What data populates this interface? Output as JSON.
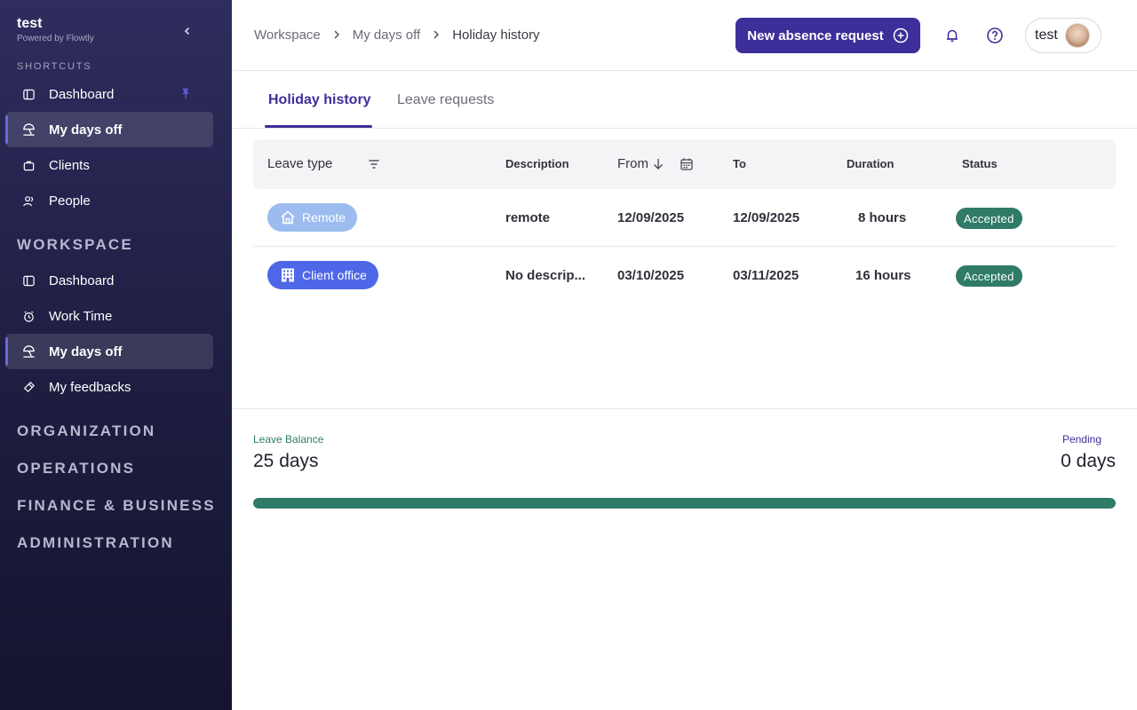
{
  "brand": {
    "name": "test",
    "tagline": "Powered by Flowtly"
  },
  "sidebar": {
    "shortcuts_title": "SHORTCUTS",
    "shortcuts": [
      {
        "label": "Dashboard",
        "icon": "layout-icon",
        "pinned": true
      },
      {
        "label": "My days off",
        "icon": "beach-icon",
        "active": true
      },
      {
        "label": "Clients",
        "icon": "briefcase-icon"
      },
      {
        "label": "People",
        "icon": "people-icon"
      }
    ],
    "workspace_title": "WORKSPACE",
    "workspace": [
      {
        "label": "Dashboard",
        "icon": "layout-icon"
      },
      {
        "label": "Work Time",
        "icon": "clock-icon"
      },
      {
        "label": "My days off",
        "icon": "beach-icon",
        "active": true
      },
      {
        "label": "My feedbacks",
        "icon": "feedback-icon"
      }
    ],
    "sections": [
      "ORGANIZATION",
      "OPERATIONS",
      "FINANCE & BUSINESS",
      "ADMINISTRATION"
    ]
  },
  "header": {
    "breadcrumb": [
      "Workspace",
      "My days off",
      "Holiday history"
    ],
    "new_button": "New absence request",
    "user": "test"
  },
  "tabs": [
    {
      "label": "Holiday history",
      "active": true
    },
    {
      "label": "Leave requests",
      "active": false
    }
  ],
  "table": {
    "columns": {
      "leave_type": "Leave type",
      "description": "Description",
      "from": "From",
      "to": "To",
      "duration": "Duration",
      "status": "Status"
    },
    "rows": [
      {
        "type": "Remote",
        "description": "remote",
        "from": "12/09/2025",
        "to": "12/09/2025",
        "duration": "8 hours",
        "status": "Accepted"
      },
      {
        "type": "Client office",
        "description": "No descrip...",
        "from": "03/10/2025",
        "to": "03/11/2025",
        "duration": "16 hours",
        "status": "Accepted"
      }
    ]
  },
  "balance": {
    "label": "Leave Balance",
    "value": "25 days",
    "pending_label": "Pending",
    "pending_value": "0 days",
    "used_fraction": 1.0
  },
  "colors": {
    "accent": "#3d2f99",
    "status_accepted": "#2f7b68",
    "chip_remote": "#9cbcf0",
    "chip_office": "#4d67e8"
  }
}
